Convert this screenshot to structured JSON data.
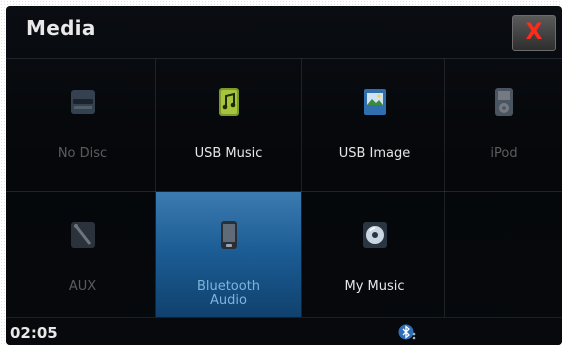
{
  "window": {
    "title": "Media"
  },
  "close_button": {
    "label": "X",
    "color": "#ff2a1a"
  },
  "tiles": [
    {
      "label": "No Disc",
      "icon": "disc-tray-icon",
      "enabled": false
    },
    {
      "label": "USB Music",
      "icon": "usb-music-icon",
      "enabled": true
    },
    {
      "label": "USB Image",
      "icon": "usb-image-icon",
      "enabled": true
    },
    {
      "label": "iPod",
      "icon": "ipod-icon",
      "enabled": false
    },
    {
      "label": "AUX",
      "icon": "aux-cable-icon",
      "enabled": false
    },
    {
      "label": "Bluetooth Audio",
      "label_line1": "Bluetooth",
      "label_line2": "Audio",
      "icon": "bluetooth-phone-icon",
      "enabled": true,
      "selected": true
    },
    {
      "label": "My Music",
      "icon": "cd-icon",
      "enabled": true
    }
  ],
  "status": {
    "time": "02:05",
    "bluetooth_icon": "bluetooth-icon"
  },
  "colors": {
    "selected_tile": "#2a6aa3",
    "background": "#05070a"
  }
}
